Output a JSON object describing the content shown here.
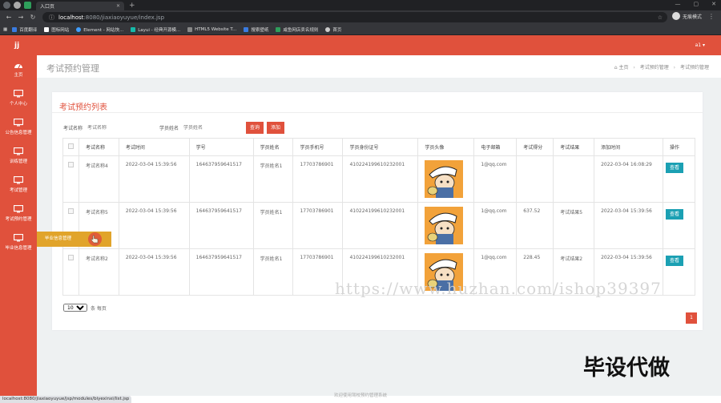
{
  "browser": {
    "tab_title": "入口页",
    "url_host": "localhost",
    "url_path": ":8080/jiaxiaoyuyue/index.jsp",
    "profile_label": "无痕模式",
    "bookmarks": [
      "百度翻译",
      "图标网站",
      "Element - 网站快...",
      "Layui - 经典开源模...",
      "HTML5 Website T...",
      "搜索壁纸",
      "咸鱼网店卖名规则",
      "首页"
    ],
    "status_url": "localhost:8080/jiaxiaoyuyue/jsp/modules/biyexinxi/list.jsp"
  },
  "app": {
    "logo": "jj",
    "user_label": "a1 ▾"
  },
  "sidebar": {
    "items": [
      {
        "label": "主页",
        "icon": "dashboard-icon"
      },
      {
        "label": "个人中心",
        "icon": "monitor-icon"
      },
      {
        "label": "公告信息管理",
        "icon": "monitor-icon"
      },
      {
        "label": "训练管理",
        "icon": "monitor-icon"
      },
      {
        "label": "考试管理",
        "icon": "monitor-icon"
      },
      {
        "label": "考试预约管理",
        "icon": "monitor-icon"
      },
      {
        "label": "毕业信息管理",
        "icon": "monitor-icon"
      }
    ],
    "tooltip": "毕业信息管理"
  },
  "page": {
    "title": "考试预约管理",
    "breadcrumb": [
      "主页",
      "考试预约管理",
      "考试预约管理"
    ]
  },
  "card": {
    "title": "考试预约列表",
    "search": {
      "exam_label": "考试名称",
      "exam_placeholder": "考试名称",
      "student_label": "学员姓名",
      "student_placeholder": "学员姓名",
      "search_button": "查询",
      "add_button": "添加"
    },
    "columns": [
      "考试名称",
      "考试时间",
      "学号",
      "学员姓名",
      "学员手机号",
      "学员身份证号",
      "学员头像",
      "电子邮箱",
      "考试得分",
      "考试结果",
      "添加时间",
      "操作"
    ],
    "rows": [
      {
        "exam_name": "考试名称4",
        "exam_time": "2022-03-04 15:39:56",
        "student_no": "1646379596415​17",
        "student_name": "学员姓名1",
        "phone": "17703786901",
        "id_card": "410224199610232001",
        "email": "1@qq.com",
        "score": "",
        "result": "",
        "added": "2022-03-04 16:08:29",
        "action": "查看"
      },
      {
        "exam_name": "考试名称5",
        "exam_time": "2022-03-04 15:39:56",
        "student_no": "1646379596415​17",
        "student_name": "学员姓名1",
        "phone": "17703786901",
        "id_card": "410224199610232001",
        "email": "1@qq.com",
        "score": "637.52",
        "result": "考试结果5",
        "added": "2022-03-04 15:39:56",
        "action": "查看"
      },
      {
        "exam_name": "考试名称2",
        "exam_time": "2022-03-04 15:39:56",
        "student_no": "1646379596415​17",
        "student_name": "学员姓名1",
        "phone": "17703786901",
        "id_card": "410224199610232001",
        "email": "1@qq.com",
        "score": "228.45",
        "result": "考试结果2",
        "added": "2022-03-04 15:39:56",
        "action": "查看"
      }
    ],
    "page_size": "10",
    "page_size_suffix": "条 每页",
    "current_page": "1"
  },
  "watermark": "https://www.huzhan.com/ishop39397",
  "overlay_text": "毕设代做",
  "footer": "欢迎使用驾校预约管理系统"
}
